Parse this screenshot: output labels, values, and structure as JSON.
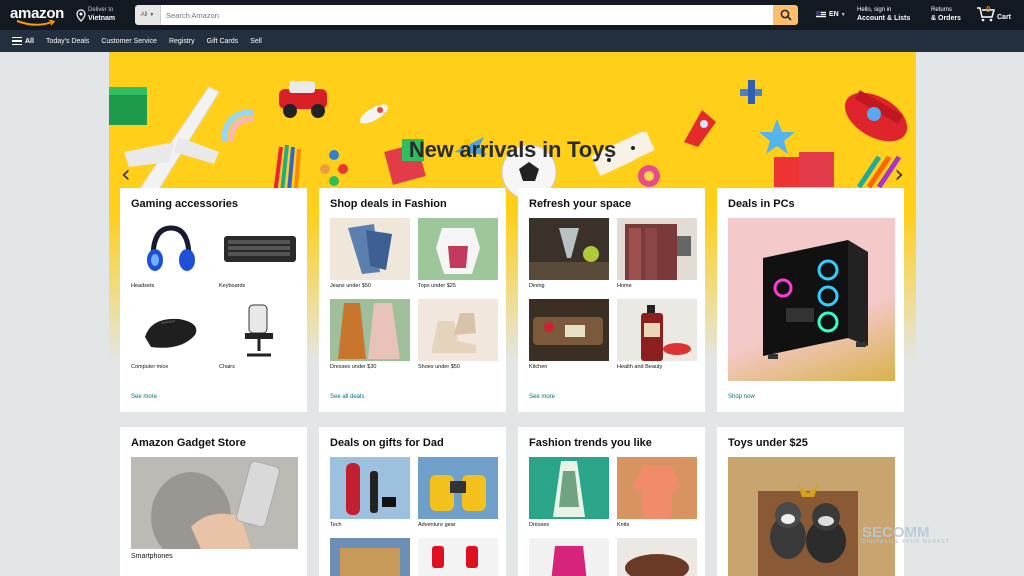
{
  "header": {
    "logo": "amazon",
    "deliver_line1": "Deliver to",
    "deliver_line2": "Vietnam",
    "search_category": "All",
    "search_placeholder": "Search Amazon",
    "language": "EN",
    "account_line1": "Hello, sign in",
    "account_line2": "Account & Lists",
    "returns_line1": "Returns",
    "returns_line2": "& Orders",
    "cart_count": "0",
    "cart_label": "Cart",
    "colors": {
      "nav": "#131921",
      "subnav": "#232f3e",
      "search_button": "#febd69",
      "link": "#007185"
    }
  },
  "subnav": {
    "all_label": "All",
    "items": [
      "Today's Deals",
      "Customer Service",
      "Registry",
      "Gift Cards",
      "Sell"
    ]
  },
  "hero": {
    "title": "New arrivals in Toys",
    "prev_icon": "chevron-left-icon",
    "next_icon": "chevron-right-icon",
    "background": "#ffcf1a"
  },
  "cards": [
    {
      "title": "Gaming accessories",
      "tiles": [
        "Headsets",
        "Keyboards",
        "Computer mice",
        "Chairs"
      ],
      "link": "See more"
    },
    {
      "title": "Shop deals in Fashion",
      "tiles": [
        "Jeans under $50",
        "Tops under $25",
        "Dresses under $30",
        "Shoes under $50"
      ],
      "link": "See all deals"
    },
    {
      "title": "Refresh your space",
      "tiles": [
        "Dining",
        "Home",
        "Kitchen",
        "Health and Beauty"
      ],
      "link": "See more"
    },
    {
      "title": "Deals in PCs",
      "link": "Shop now"
    },
    {
      "title": "Amazon Gadget Store",
      "tiles": [
        "Smartphones"
      ]
    },
    {
      "title": "Deals on gifts for Dad",
      "tiles": [
        "Tech",
        "Adventure gear"
      ]
    },
    {
      "title": "Fashion trends you like",
      "tiles": [
        "Dresses",
        "Knits"
      ]
    },
    {
      "title": "Toys under $25"
    }
  ],
  "watermark": {
    "brand": "SECOMM",
    "tagline": "DIGITALIZE YOUR MARKET"
  }
}
